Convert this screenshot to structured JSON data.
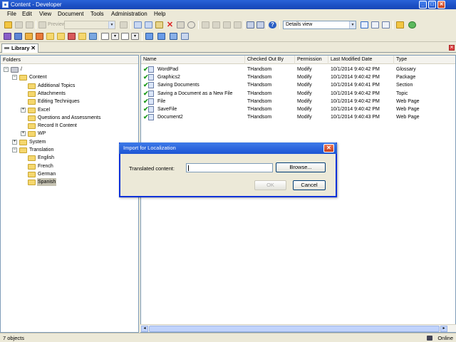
{
  "window": {
    "title": "Content - Developer"
  },
  "menu": [
    "File",
    "Edit",
    "View",
    "Document",
    "Tools",
    "Administration",
    "Help"
  ],
  "toolbar": {
    "preview_label": "Preview",
    "view_select": "Details view"
  },
  "library_tab": {
    "label": "Library",
    "close": "✕"
  },
  "folders": {
    "header": "Folders",
    "tree": [
      {
        "label": "/",
        "depth": 0,
        "expander": "−"
      },
      {
        "label": "Content",
        "depth": 1,
        "expander": "−"
      },
      {
        "label": "Additional Topics",
        "depth": 2,
        "expander": ""
      },
      {
        "label": "Attachments",
        "depth": 2,
        "expander": ""
      },
      {
        "label": "Editing Techniques",
        "depth": 2,
        "expander": ""
      },
      {
        "label": "Excel",
        "depth": 2,
        "expander": "+"
      },
      {
        "label": "Questions and Assessments",
        "depth": 2,
        "expander": ""
      },
      {
        "label": "Record It Content",
        "depth": 2,
        "expander": ""
      },
      {
        "label": "WP",
        "depth": 2,
        "expander": "+"
      },
      {
        "label": "System",
        "depth": 1,
        "expander": "+"
      },
      {
        "label": "Translation",
        "depth": 1,
        "expander": "−"
      },
      {
        "label": "English",
        "depth": 2,
        "expander": ""
      },
      {
        "label": "French",
        "depth": 2,
        "expander": ""
      },
      {
        "label": "German",
        "depth": 2,
        "expander": ""
      },
      {
        "label": "Spanish",
        "depth": 2,
        "expander": "",
        "selected": true
      }
    ]
  },
  "files": {
    "columns": [
      "Name",
      "Checked Out By",
      "Permission",
      "Last Modified Date",
      "Type"
    ],
    "rows": [
      [
        "WordPad",
        "THandsom",
        "Modify",
        "10/1/2014 9:40:42 PM",
        "Glossary"
      ],
      [
        "Graphics2",
        "THandsom",
        "Modify",
        "10/1/2014 9:40:42 PM",
        "Package"
      ],
      [
        "Saving Documents",
        "THandsom",
        "Modify",
        "10/1/2014 9:40:41 PM",
        "Section"
      ],
      [
        "Saving a Document as a New File",
        "THandsom",
        "Modify",
        "10/1/2014 9:40:42 PM",
        "Topic"
      ],
      [
        "File",
        "THandsom",
        "Modify",
        "10/1/2014 9:40:42 PM",
        "Web Page"
      ],
      [
        "SaveFile",
        "THandsom",
        "Modify",
        "10/1/2014 9:40:42 PM",
        "Web Page"
      ],
      [
        "Document2",
        "THandsom",
        "Modify",
        "10/1/2014 9:40:43 PM",
        "Web Page"
      ]
    ]
  },
  "dialog": {
    "title": "Import for Localization",
    "close": "✕",
    "label": "Translated content:",
    "input_value": "",
    "browse": "Browse...",
    "ok": "OK",
    "cancel": "Cancel"
  },
  "status": {
    "left": "7 objects",
    "right": "Online"
  }
}
